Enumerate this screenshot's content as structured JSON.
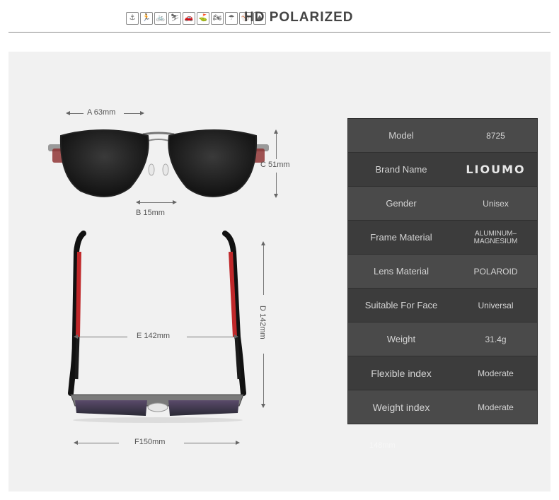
{
  "header": {
    "icons": [
      "fishing-icon",
      "running-icon",
      "cycling-icon",
      "skiing-icon",
      "driving-icon",
      "golf-icon",
      "motorcycle-icon",
      "beach-icon",
      "baseball-icon",
      "hiking-icon"
    ],
    "title": "HD POLARIZED"
  },
  "dimensions": {
    "a": "A 63mm",
    "b": "B 15mm",
    "c": "C 51mm",
    "d": "D 142mm",
    "e": "E 142mm",
    "f": "F150mm"
  },
  "specs": [
    {
      "label": "Model",
      "value": "8725"
    },
    {
      "label": "Brand Name",
      "value": "LIOUMO"
    },
    {
      "label": "Gender",
      "value": "Unisex"
    },
    {
      "label": "Frame Material",
      "value": "ALUMINUM–MAGNESIUM"
    },
    {
      "label": "Lens Material",
      "value": "POLAROID"
    },
    {
      "label": "Suitable For Face",
      "value": "Universal"
    },
    {
      "label": "Weight",
      "value": "31.4g"
    },
    {
      "label": "Flexible index",
      "value": "Moderate"
    },
    {
      "label": "Weight index",
      "value": "Moderate"
    }
  ],
  "ghost_text": "148mm"
}
